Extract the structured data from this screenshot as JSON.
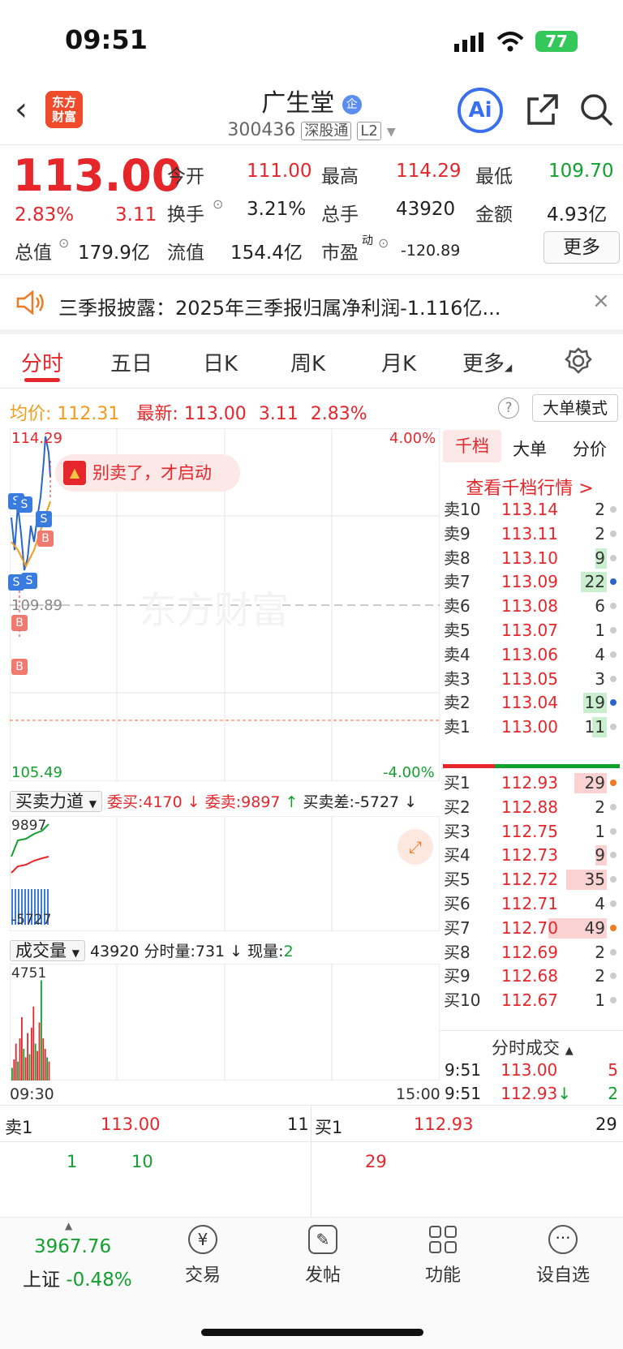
{
  "status_bar": {
    "time": "09:51",
    "battery": "77"
  },
  "header": {
    "logo": "东方\n财富",
    "stock_name": "广生堂",
    "badge": "企",
    "code": "300436",
    "tag1": "深股通",
    "tag2": "L2",
    "ai": "Ai"
  },
  "quote": {
    "price": "113.00",
    "change_pct": "2.83%",
    "change": "3.11",
    "open_label": "今开",
    "open": "111.00",
    "high_label": "最高",
    "high": "114.29",
    "low_label": "最低",
    "low": "109.70",
    "turnover_label": "换手",
    "turnover": "3.21%",
    "total_hands_label": "总手",
    "total_hands": "43920",
    "amount_label": "金额",
    "amount": "4.93亿",
    "mcap_label": "总值",
    "mcap": "179.9亿",
    "float_label": "流值",
    "float": "154.4亿",
    "pe_label": "市盈",
    "pe_sup": "动",
    "pe": "-120.89",
    "more": "更多"
  },
  "notice": {
    "text": "三季报披露：2025年三季报归属净利润-1.116亿..."
  },
  "tabs": [
    "分时",
    "五日",
    "日K",
    "周K",
    "月K",
    "更多"
  ],
  "info_row": {
    "avg_label": "均价:",
    "avg": "112.31",
    "latest_label": "最新:",
    "latest": "113.00",
    "chg": "3.11",
    "chg_pct": "2.83%",
    "help": "?",
    "mode": "大单模式"
  },
  "chart": {
    "y_top": "114.29",
    "y_top_pct": "4.00%",
    "y_mid": "109.89",
    "y_bottom": "105.49",
    "y_bottom_pct": "-4.00%",
    "banner": "别卖了，才启动",
    "watermark": "东方财富",
    "markers": [
      "S",
      "S",
      "S",
      "B",
      "S",
      "S",
      "B",
      "B"
    ]
  },
  "indicator": {
    "name": "买卖力道",
    "buy_label": "委买:",
    "buy": "4170",
    "sell_label": "委卖:",
    "sell": "9897",
    "diff_label": "买卖差:",
    "diff": "-5727",
    "top": "9897",
    "bottom": "-5727"
  },
  "volume": {
    "name": "成交量",
    "total": "43920",
    "min_label": "分时量:",
    "min": "731",
    "now_label": "现量:",
    "now": "2",
    "top": "4751",
    "t_start": "09:30",
    "t_end": "15:00",
    "bars": [
      12,
      20,
      35,
      18,
      40,
      60,
      30,
      22,
      45,
      25,
      50,
      70,
      35,
      28,
      55,
      95,
      40,
      30,
      22,
      18
    ]
  },
  "orderbook": {
    "tabs": [
      "千档",
      "大单",
      "分价"
    ],
    "link": "查看千档行情 >",
    "asks": [
      {
        "label": "卖10",
        "price": "113.14",
        "vol": "2",
        "fill": 0,
        "dot": "gray"
      },
      {
        "label": "卖9",
        "price": "113.11",
        "vol": "2",
        "fill": 0,
        "dot": "gray"
      },
      {
        "label": "卖8",
        "price": "113.10",
        "vol": "9",
        "fill": 0.2,
        "dot": "gray"
      },
      {
        "label": "卖7",
        "price": "113.09",
        "vol": "22",
        "fill": 0.45,
        "dot": "blue"
      },
      {
        "label": "卖6",
        "price": "113.08",
        "vol": "6",
        "fill": 0,
        "dot": "gray"
      },
      {
        "label": "卖5",
        "price": "113.07",
        "vol": "1",
        "fill": 0,
        "dot": "gray"
      },
      {
        "label": "卖4",
        "price": "113.06",
        "vol": "4",
        "fill": 0,
        "dot": "gray"
      },
      {
        "label": "卖3",
        "price": "113.05",
        "vol": "3",
        "fill": 0,
        "dot": "gray"
      },
      {
        "label": "卖2",
        "price": "113.04",
        "vol": "19",
        "fill": 0.4,
        "dot": "blue"
      },
      {
        "label": "卖1",
        "price": "113.00",
        "vol": "11",
        "fill": 0.25,
        "dot": "gray"
      }
    ],
    "bids": [
      {
        "label": "买1",
        "price": "112.93",
        "vol": "29",
        "fill": 0.55,
        "dot": "orange"
      },
      {
        "label": "买2",
        "price": "112.88",
        "vol": "2",
        "fill": 0,
        "dot": "gray"
      },
      {
        "label": "买3",
        "price": "112.75",
        "vol": "1",
        "fill": 0,
        "dot": "gray"
      },
      {
        "label": "买4",
        "price": "112.73",
        "vol": "9",
        "fill": 0.2,
        "dot": "gray"
      },
      {
        "label": "买5",
        "price": "112.72",
        "vol": "35",
        "fill": 0.7,
        "dot": "gray"
      },
      {
        "label": "买6",
        "price": "112.71",
        "vol": "4",
        "fill": 0,
        "dot": "gray"
      },
      {
        "label": "买7",
        "price": "112.70",
        "vol": "49",
        "fill": 1.0,
        "dot": "orange"
      },
      {
        "label": "买8",
        "price": "112.69",
        "vol": "2",
        "fill": 0,
        "dot": "gray"
      },
      {
        "label": "买9",
        "price": "112.68",
        "vol": "2",
        "fill": 0,
        "dot": "gray"
      },
      {
        "label": "买10",
        "price": "112.67",
        "vol": "1",
        "fill": 0,
        "dot": "gray"
      }
    ],
    "trades_title": "分时成交",
    "trades": [
      {
        "time": "9:51",
        "price": "113.00",
        "vol": "5",
        "color": "red",
        "arrow": ""
      },
      {
        "time": "9:51",
        "price": "112.93",
        "vol": "2",
        "color": "green",
        "arrow": "↓"
      }
    ]
  },
  "bottom_quote": {
    "sell_label": "卖1",
    "sell_price": "113.00",
    "sell_vol": "11",
    "buy_label": "买1",
    "buy_price": "112.93",
    "buy_vol": "29",
    "left_vals": [
      "1",
      "10"
    ],
    "right_vals": [
      "29"
    ]
  },
  "bottom_nav": {
    "index_value": "3967.76",
    "index_name": "上证",
    "index_chg": "-0.48%",
    "items": [
      "交易",
      "发帖",
      "功能",
      "设自选"
    ]
  }
}
